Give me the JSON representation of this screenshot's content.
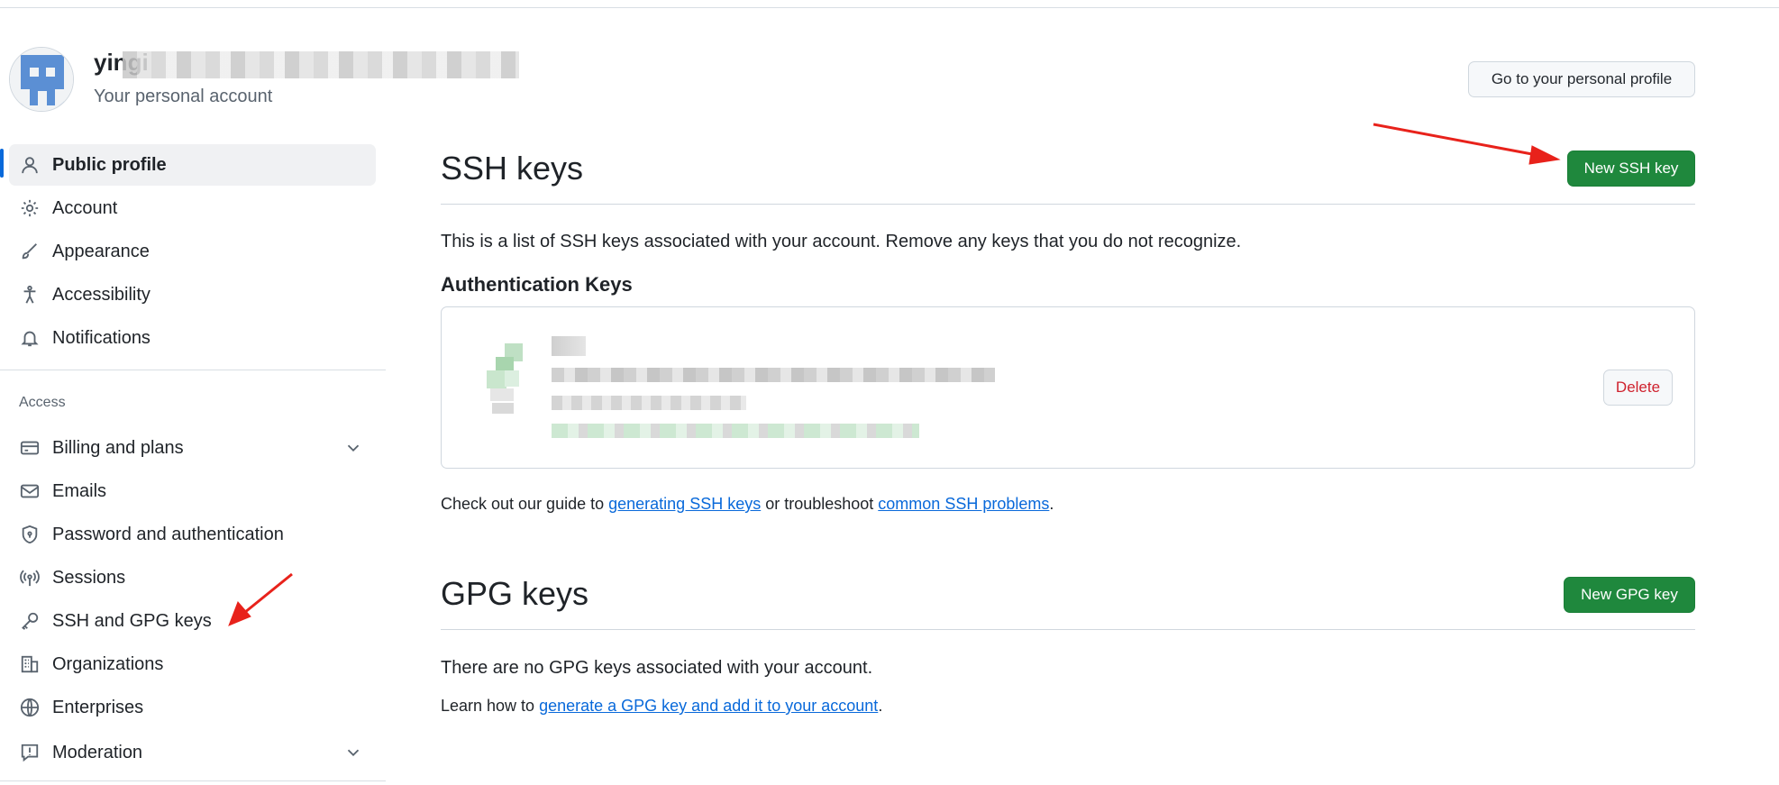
{
  "account": {
    "name_visible": "yingi",
    "subtitle": "Your personal account",
    "profile_button": "Go to your personal profile"
  },
  "sidebar": {
    "items": [
      {
        "label": "Public profile",
        "icon": "person-icon"
      },
      {
        "label": "Account",
        "icon": "gear-icon"
      },
      {
        "label": "Appearance",
        "icon": "paintbrush-icon"
      },
      {
        "label": "Accessibility",
        "icon": "accessibility-icon"
      },
      {
        "label": "Notifications",
        "icon": "bell-icon"
      }
    ],
    "access_heading": "Access",
    "access_items": [
      {
        "label": "Billing and plans",
        "icon": "credit-card-icon"
      },
      {
        "label": "Emails",
        "icon": "mail-icon"
      },
      {
        "label": "Password and authentication",
        "icon": "shield-icon"
      },
      {
        "label": "Sessions",
        "icon": "broadcast-icon"
      },
      {
        "label": "SSH and GPG keys",
        "icon": "key-icon"
      },
      {
        "label": "Organizations",
        "icon": "organization-icon"
      },
      {
        "label": "Enterprises",
        "icon": "globe-icon"
      },
      {
        "label": "Moderation",
        "icon": "report-icon"
      }
    ]
  },
  "ssh": {
    "title": "SSH keys",
    "new_button": "New SSH key",
    "description": "This is a list of SSH keys associated with your account. Remove any keys that you do not recognize.",
    "auth_heading": "Authentication Keys",
    "delete_button": "Delete",
    "guide_prefix": "Check out our guide to ",
    "guide_link1": "generating SSH keys",
    "guide_middle": " or troubleshoot ",
    "guide_link2": "common SSH problems",
    "guide_suffix": "."
  },
  "gpg": {
    "title": "GPG keys",
    "new_button": "New GPG key",
    "empty_text": "There are no GPG keys associated with your account.",
    "learn_prefix": "Learn how to ",
    "learn_link": "generate a GPG key and add it to your account",
    "learn_suffix": "."
  },
  "colors": {
    "accent": "#0969da",
    "primary_button": "#1f883d",
    "danger": "#cf222e",
    "annotation_arrow": "#e8221b"
  }
}
